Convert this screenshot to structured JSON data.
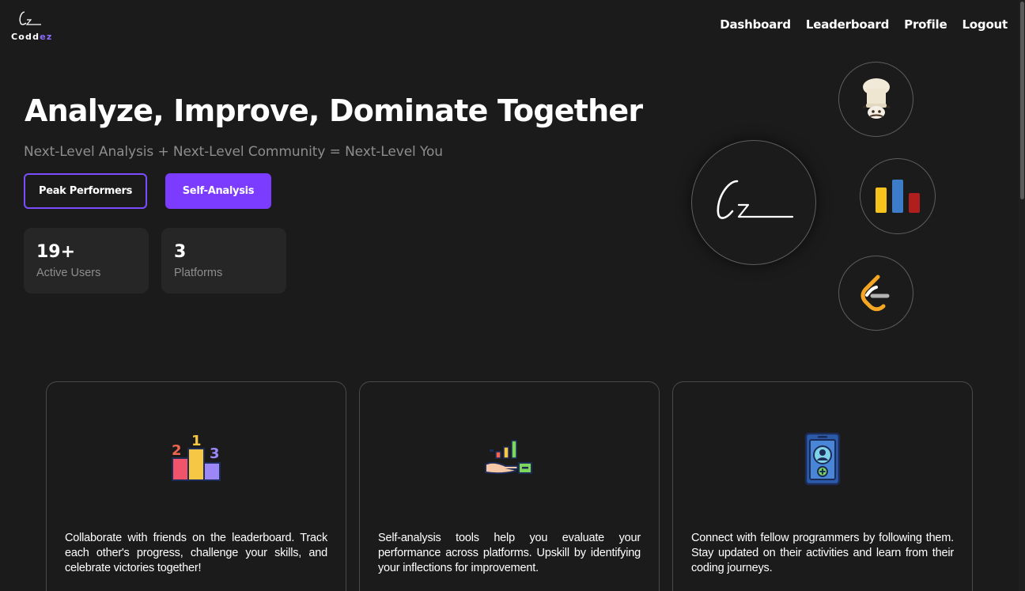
{
  "logo": {
    "text_part1": "Codd",
    "text_part2": "ez",
    "icon": "cz-signature-icon"
  },
  "nav": {
    "items": [
      "Dashboard",
      "Leaderboard",
      "Profile",
      "Logout"
    ]
  },
  "hero": {
    "title": "Analyze, Improve, Dominate Together",
    "subtitle": "Next-Level Analysis + Next-Level Community = Next-Level You",
    "primary_button": "Peak Performers",
    "secondary_button": "Self-Analysis"
  },
  "stats": [
    {
      "value": "19+",
      "label": "Active Users"
    },
    {
      "value": "3",
      "label": "Platforms"
    }
  ],
  "platform_icons": [
    "codechef-icon",
    "codeforces-icon",
    "leetcode-icon"
  ],
  "features": [
    {
      "icon": "podium-icon",
      "description": "Collaborate with friends on the leaderboard. Track each other's progress, challenge your skills, and celebrate victories together!"
    },
    {
      "icon": "growth-hand-icon",
      "description": "Self-analysis tools help you evaluate your performance across platforms. Upskill by identifying your inflections for improvement."
    },
    {
      "icon": "follow-user-phone-icon",
      "description": "Connect with fellow programmers by following them. Stay updated on their activities and learn from their coding journeys."
    }
  ],
  "colors": {
    "background": "#1b1b1b",
    "accent": "#7c3cff",
    "card_bg": "#262626",
    "muted_text": "#8d8d8d"
  }
}
